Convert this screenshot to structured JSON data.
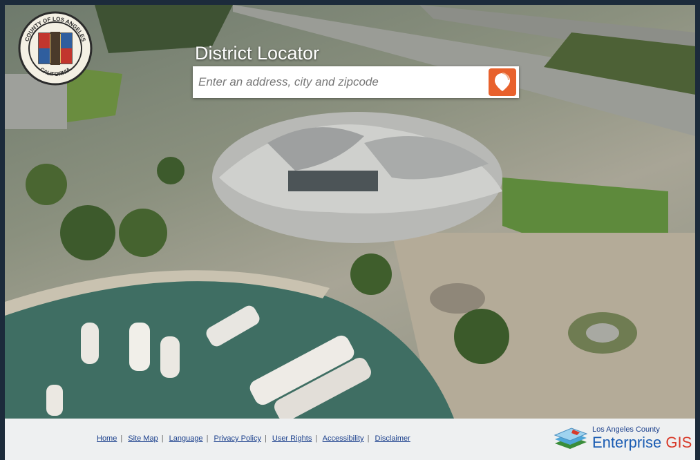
{
  "header": {
    "title": "District Locator"
  },
  "search": {
    "placeholder": "Enter an address, city and zipcode",
    "value": ""
  },
  "seal": {
    "top_text": "COUNTY OF LOS ANGELES",
    "bottom_text": "CALIFORNIA"
  },
  "footer": {
    "links": [
      "Home",
      "Site Map",
      "Language",
      "Privacy Policy",
      "User Rights",
      "Accessibility",
      "Disclaimer"
    ],
    "separator": "|"
  },
  "logo": {
    "line1": "Los Angeles County",
    "word1": "Enterprise",
    "word2": "GIS"
  },
  "colors": {
    "accent_orange": "#e8612c",
    "link_blue": "#1a3f8c",
    "gis_red": "#d83a2a"
  }
}
